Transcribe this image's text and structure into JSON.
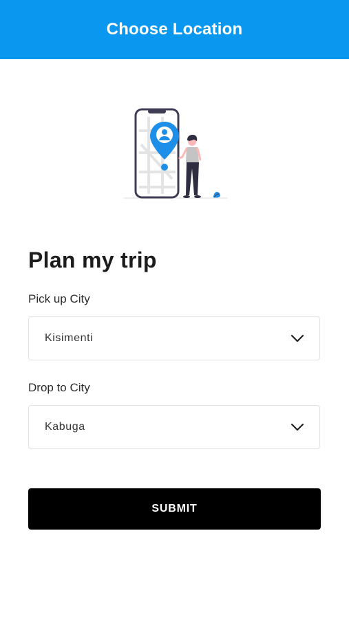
{
  "header": {
    "title": "Choose Location"
  },
  "illustration": {
    "icon": "location-pin-phone-illustration"
  },
  "trip_form": {
    "heading": "Plan my trip",
    "pickup": {
      "label": "Pick up City",
      "selected_value": "Kisimenti"
    },
    "dropoff": {
      "label": "Drop to City",
      "selected_value": "Kabuga"
    },
    "submit_label": "SUBMIT"
  },
  "colors": {
    "header_bg": "#0a97f0",
    "button_bg": "#000000",
    "accent": "#1e8fe8"
  }
}
